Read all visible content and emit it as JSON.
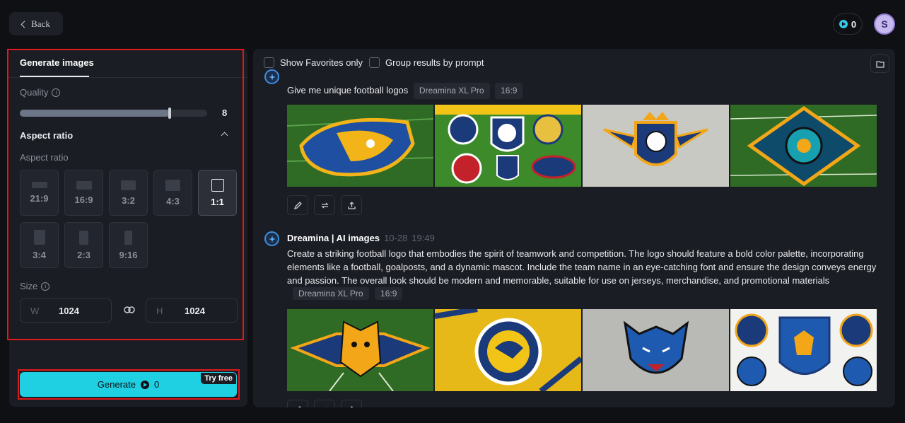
{
  "topbar": {
    "back_label": "Back",
    "credits": "0"
  },
  "left_panel": {
    "tab": "Generate images",
    "quality": {
      "label": "Quality",
      "value": "8",
      "fraction": 0.8
    },
    "aspect_section_title": "Aspect ratio",
    "aspect_label": "Aspect ratio",
    "ratios": [
      "21:9",
      "16:9",
      "3:2",
      "4:3",
      "1:1",
      "3:4",
      "2:3",
      "9:16"
    ],
    "selected_ratio": "1:1",
    "size": {
      "label": "Size",
      "w_label": "W",
      "w_value": "1024",
      "h_label": "H",
      "h_value": "1024"
    },
    "generate": {
      "label": "Generate",
      "cost": "0",
      "badge": "Try free"
    }
  },
  "results": {
    "show_favorites": "Show Favorites only",
    "group_by_prompt": "Group results by prompt",
    "items": [
      {
        "prompt": "Give me unique football logos",
        "model": "Dreamina XL Pro",
        "ratio": "16:9"
      },
      {
        "bot_name": "Dreamina | AI images",
        "date": "10-28",
        "time": "19:49",
        "prompt": "Create a striking football logo that embodies the spirit of teamwork and competition. The logo should feature a bold color palette, incorporating elements like a football, goalposts, and a dynamic mascot. Include the team name in an eye-catching font and ensure the design conveys energy and passion. The overall look should be modern and memorable, suitable for use on jerseys, merchandise, and promotional materials",
        "model": "Dreamina XL Pro",
        "ratio": "16:9"
      }
    ]
  },
  "colors": {
    "accent": "#1fd0e2",
    "highlight_border": "#e0191c"
  }
}
